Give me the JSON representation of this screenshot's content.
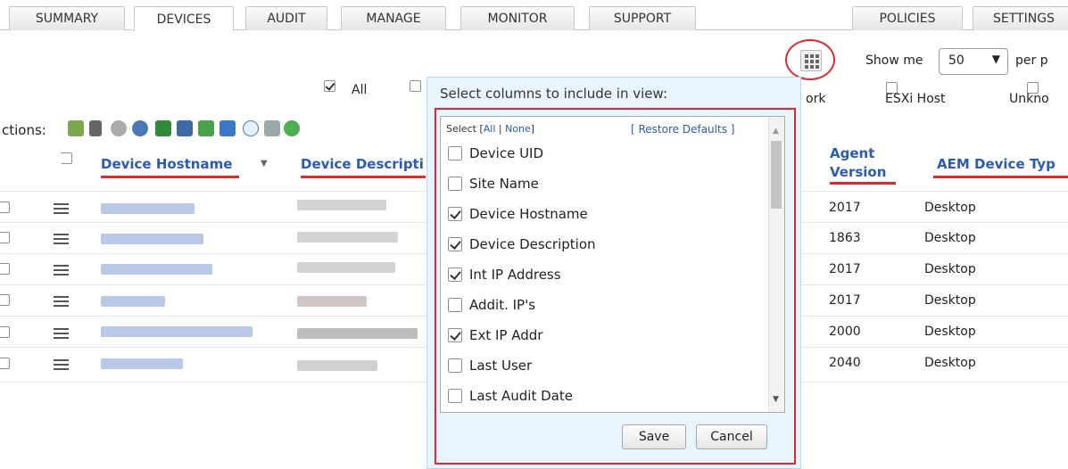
{
  "tabs": {
    "summary": "SUMMARY",
    "devices": "DEVICES",
    "audit": "AUDIT",
    "manage": "MANAGE",
    "monitor": "MONITOR",
    "support": "SUPPORT",
    "policies": "POLICIES",
    "settings": "SETTINGS"
  },
  "pager": {
    "show_me": "Show me",
    "page_size": "50",
    "per_page": "per p"
  },
  "filters": {
    "all": "All",
    "network_partial": "ork",
    "esxi": "ESXi Host",
    "unknown_partial": "Unkno"
  },
  "actions_label": "ctions:",
  "table": {
    "headers": {
      "hostname": "Device Hostname",
      "description": "Device Descripti",
      "agent_version_line1": "Agent",
      "agent_version_line2": "Version",
      "device_type": "AEM Device Typ"
    },
    "rows": [
      {
        "agent_version": "2017",
        "device_type": "Desktop"
      },
      {
        "agent_version": "1863",
        "device_type": "Desktop"
      },
      {
        "agent_version": "2017",
        "device_type": "Desktop"
      },
      {
        "agent_version": "2017",
        "device_type": "Desktop"
      },
      {
        "agent_version": "2000",
        "device_type": "Desktop"
      },
      {
        "agent_version": "2040",
        "device_type": "Desktop"
      }
    ]
  },
  "column_picker": {
    "title": "Select columns to include in view:",
    "select_label": "Select [",
    "all_link": "All",
    "separator": "|",
    "none_link": "None",
    "close_bracket": "]",
    "restore_defaults": "[ Restore Defaults ]",
    "options": [
      {
        "label": "Device UID",
        "checked": false
      },
      {
        "label": "Site Name",
        "checked": false
      },
      {
        "label": "Device Hostname",
        "checked": true
      },
      {
        "label": "Device Description",
        "checked": true
      },
      {
        "label": "Int IP Address",
        "checked": true
      },
      {
        "label": "Addit. IP's",
        "checked": false
      },
      {
        "label": "Ext IP Addr",
        "checked": true
      },
      {
        "label": "Last User",
        "checked": false
      },
      {
        "label": "Last Audit Date",
        "checked": false
      }
    ],
    "save": "Save",
    "cancel": "Cancel"
  },
  "colors": {
    "link_blue": "#2a5bb5",
    "highlight_red": "#e4262d",
    "popup_bg": "#e9f5fc"
  }
}
